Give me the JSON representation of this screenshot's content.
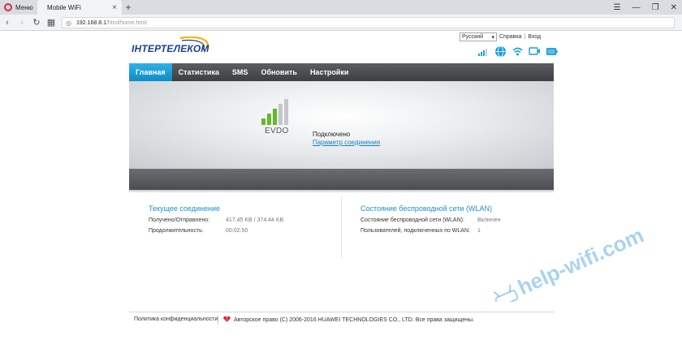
{
  "browser": {
    "menu_label": "Меню",
    "tab_title": "Mobile WiFi",
    "tab_close": "×",
    "new_tab": "+",
    "url_host": "192.168.8.1",
    "url_path": "/html/home.html"
  },
  "header": {
    "logo_text": "ІНТЕРТЕЛЕКОМ",
    "language": "Русский",
    "help_link": "Справка",
    "separator": "|",
    "login_link": "Вход"
  },
  "nav": {
    "items": [
      "Главная",
      "Статистика",
      "SMS",
      "Обновить",
      "Настройки"
    ],
    "active_index": 0
  },
  "hero": {
    "network_type": "EVDO",
    "signal_bars_active": 3,
    "signal_bars_total": 5,
    "connection_status": "Подключено",
    "connection_params_link": "Параметр соединения"
  },
  "current_connection": {
    "title": "Текущее соединение",
    "received_sent_label": "Получено/Отправлено:",
    "received_sent_value": "417.45 KB / 374.44 KB",
    "duration_label": "Продолжительность:",
    "duration_value": "00:02:50"
  },
  "wlan": {
    "title": "Состояние беспроводной сети (WLAN)",
    "status_label": "Состояние беспроводной сети (WLAN):",
    "status_value": "Включен",
    "users_label": "Пользователей, подключенных по WLAN:",
    "users_value": "1"
  },
  "footer": {
    "privacy": "Политика конфиденциальности",
    "copyright": "Авторское право (C) 2006-2016 HUAWEI TECHNOLOGIES CO., LTD. Все права защищены."
  },
  "watermark": {
    "text": "help-wifi.com"
  },
  "colors": {
    "accent_blue": "#1a8fcf",
    "nav_active": "#1a9fdb",
    "signal_green": "#6bb52e",
    "signal_gray": "#c4c7ca",
    "opera_red": "#e0262e"
  }
}
